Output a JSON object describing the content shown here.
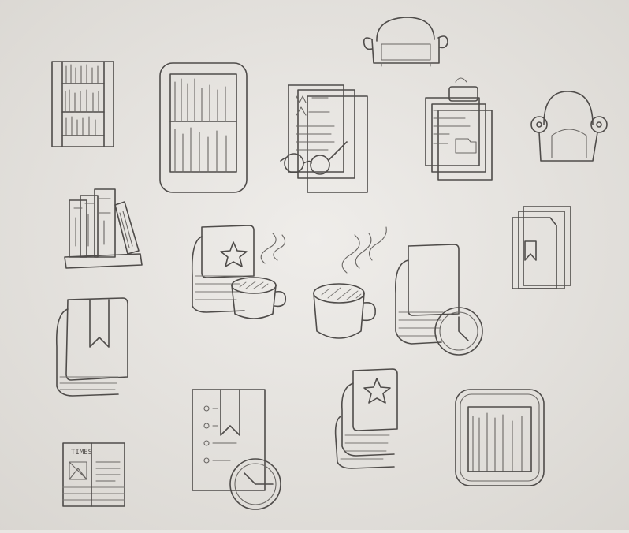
{
  "colors": {
    "paper": "#e9e7e3",
    "pencil": "#4f4c4a",
    "pencil_light": "#6a6764",
    "shade": "#7a7774"
  },
  "sketches": [
    {
      "icon": "armchair-small-icon"
    },
    {
      "icon": "bookshelf-icon"
    },
    {
      "icon": "tablet-bookshelf-icon"
    },
    {
      "icon": "document-with-glasses-icon"
    },
    {
      "icon": "clipboard-documents-icon"
    },
    {
      "icon": "armchair-icon"
    },
    {
      "icon": "books-on-shelf-icon"
    },
    {
      "icon": "book-stack-with-coffee-icon"
    },
    {
      "icon": "steaming-coffee-cup-icon"
    },
    {
      "icon": "book-stack-with-clock-icon"
    },
    {
      "icon": "bookmark-folder-icon"
    },
    {
      "icon": "bookmarked-book-icon"
    },
    {
      "icon": "bookmark-list-with-clock-icon"
    },
    {
      "icon": "starred-book-stack-icon"
    },
    {
      "icon": "rounded-bookshelf-icon"
    },
    {
      "icon": "newspaper-stack-icon"
    }
  ],
  "newspaper_masthead": "TIMES"
}
